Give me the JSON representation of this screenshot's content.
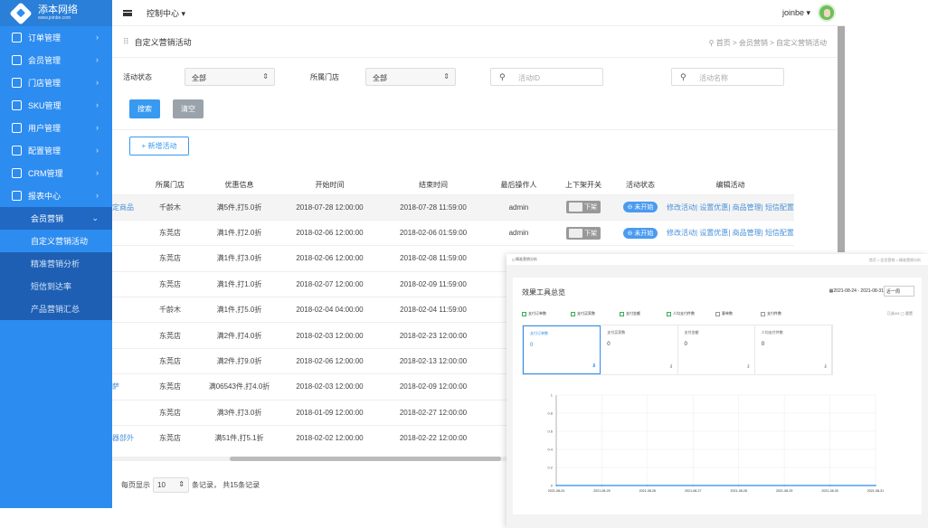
{
  "app": {
    "logo_text": "添本网络",
    "logo_sub": "www.joinbe.com"
  },
  "header": {
    "center_label": "控制中心 ▾",
    "user": "joinbe ▾"
  },
  "sidebar": {
    "items": [
      {
        "label": "订单管理"
      },
      {
        "label": "会员管理"
      },
      {
        "label": "门店管理"
      },
      {
        "label": "SKU管理"
      },
      {
        "label": "用户管理"
      },
      {
        "label": "配置管理"
      },
      {
        "label": "CRM管理"
      },
      {
        "label": "报表中心"
      }
    ],
    "open_item": {
      "label": "会员营销"
    },
    "sub_items": [
      {
        "label": "自定义营销活动"
      },
      {
        "label": "精准营销分析"
      },
      {
        "label": "短信到达率"
      },
      {
        "label": "产品营销汇总"
      }
    ]
  },
  "page": {
    "title": "自定义营销活动",
    "breadcrumb": "首页 > 会员营销 > 自定义营销活动"
  },
  "filters": {
    "status_label": "活动状态",
    "status_value": "全部",
    "store_label": "所属门店",
    "store_value": "全部",
    "id_placeholder": "活动ID",
    "name_placeholder": "活动名称",
    "search_btn": "搜索",
    "clear_btn": "清空",
    "add_btn": "+ 新增活动"
  },
  "table": {
    "headers": [
      "",
      "所属门店",
      "优惠信息",
      "开始时间",
      "结束时间",
      "最后操作人",
      "上下架开关",
      "活动状态",
      "编辑活动"
    ],
    "rows": [
      {
        "name": "定商品",
        "store": "千龄木",
        "offer": "满5件,打5.0折",
        "start": "2018-07-28 12:00:00",
        "end": "2018-07-28 11:59:00",
        "op": "admin",
        "toggle": "下架",
        "status": "未开始"
      },
      {
        "name": "",
        "store": "东莞店",
        "offer": "满1件,打2.0折",
        "start": "2018-02-06 12:00:00",
        "end": "2018-02-06 01:59:00",
        "op": "admin",
        "toggle": "下架",
        "status": "未开始"
      },
      {
        "name": "",
        "store": "东莞店",
        "offer": "满1件,打3.0折",
        "start": "2018-02-06 12:00:00",
        "end": "2018-02-08 11:59:00",
        "op": "",
        "toggle": "",
        "status": ""
      },
      {
        "name": "",
        "store": "东莞店",
        "offer": "满1件,打1.0折",
        "start": "2018-02-07 12:00:00",
        "end": "2018-02-09 11:59:00",
        "op": "",
        "toggle": "",
        "status": ""
      },
      {
        "name": "",
        "store": "千龄木",
        "offer": "满1件,打5.0折",
        "start": "2018-02-04 04:00:00",
        "end": "2018-02-04 11:59:00",
        "op": "",
        "toggle": "",
        "status": ""
      },
      {
        "name": "",
        "store": "东莞店",
        "offer": "满2件,打4.0折",
        "start": "2018-02-03 12:00:00",
        "end": "2018-02-23 12:00:00",
        "op": "",
        "toggle": "",
        "status": ""
      },
      {
        "name": "",
        "store": "东莞店",
        "offer": "满2件,打9.0折",
        "start": "2018-02-06 12:00:00",
        "end": "2018-02-13 12:00:00",
        "op": "",
        "toggle": "",
        "status": ""
      },
      {
        "name": "萨",
        "store": "东莞店",
        "offer": "满06543件,打4.0折",
        "start": "2018-02-03 12:00:00",
        "end": "2018-02-09 12:00:00",
        "op": "",
        "toggle": "",
        "status": ""
      },
      {
        "name": "",
        "store": "东莞店",
        "offer": "满3件,打3.0折",
        "start": "2018-01-09 12:00:00",
        "end": "2018-02-27 12:00:00",
        "op": "",
        "toggle": "",
        "status": ""
      },
      {
        "name": "器部外",
        "store": "东莞店",
        "offer": "满51件,打5.1折",
        "start": "2018-02-02 12:00:00",
        "end": "2018-02-22 12:00:00",
        "op": "",
        "toggle": "",
        "status": ""
      }
    ],
    "actions": [
      "修改活动",
      "设置优惠",
      "商品管理",
      "短信配置"
    ]
  },
  "pager": {
    "prefix": "每页显示",
    "size": "10",
    "suffix": "条记录， 共15条记录"
  },
  "overlay": {
    "page_title": "精准营销分析",
    "breadcrumb": "首页 > 会员营销 > 精准营销分析",
    "card_title": "效果工具总览",
    "date_range": "2021-08-24 - 2021-08-31",
    "range_select": "近一周",
    "checkboxes": [
      {
        "label": "支付订单数",
        "on": true
      },
      {
        "label": "支付买家数",
        "on": true
      },
      {
        "label": "支付金额",
        "on": true
      },
      {
        "label": "人均支付件数",
        "on": true
      },
      {
        "label": "客单数",
        "on": false
      },
      {
        "label": "支付件数",
        "on": false
      }
    ],
    "selected_info": "已选4/5 ◯ 重置",
    "kpis": [
      {
        "label": "支付订单数",
        "value": "0"
      },
      {
        "label": "支付买家数",
        "value": "0"
      },
      {
        "label": "支付金额",
        "value": "0"
      },
      {
        "label": "人均支付件数",
        "value": "0"
      }
    ]
  },
  "chart_data": {
    "type": "line",
    "x": [
      "2021-08-24",
      "2021-08-25",
      "2021-08-26",
      "2021-08-27",
      "2021-08-28",
      "2021-08-29",
      "2021-08-30",
      "2021-08-31"
    ],
    "series": [
      {
        "values": [
          0,
          0,
          0,
          0,
          0,
          0,
          0,
          0
        ]
      }
    ],
    "yticks": [
      "1",
      "0.8",
      "0.6",
      "0.4",
      "0.2",
      "0"
    ],
    "ylim": [
      0,
      1
    ],
    "grid": true,
    "color": "#2d8cf0"
  }
}
